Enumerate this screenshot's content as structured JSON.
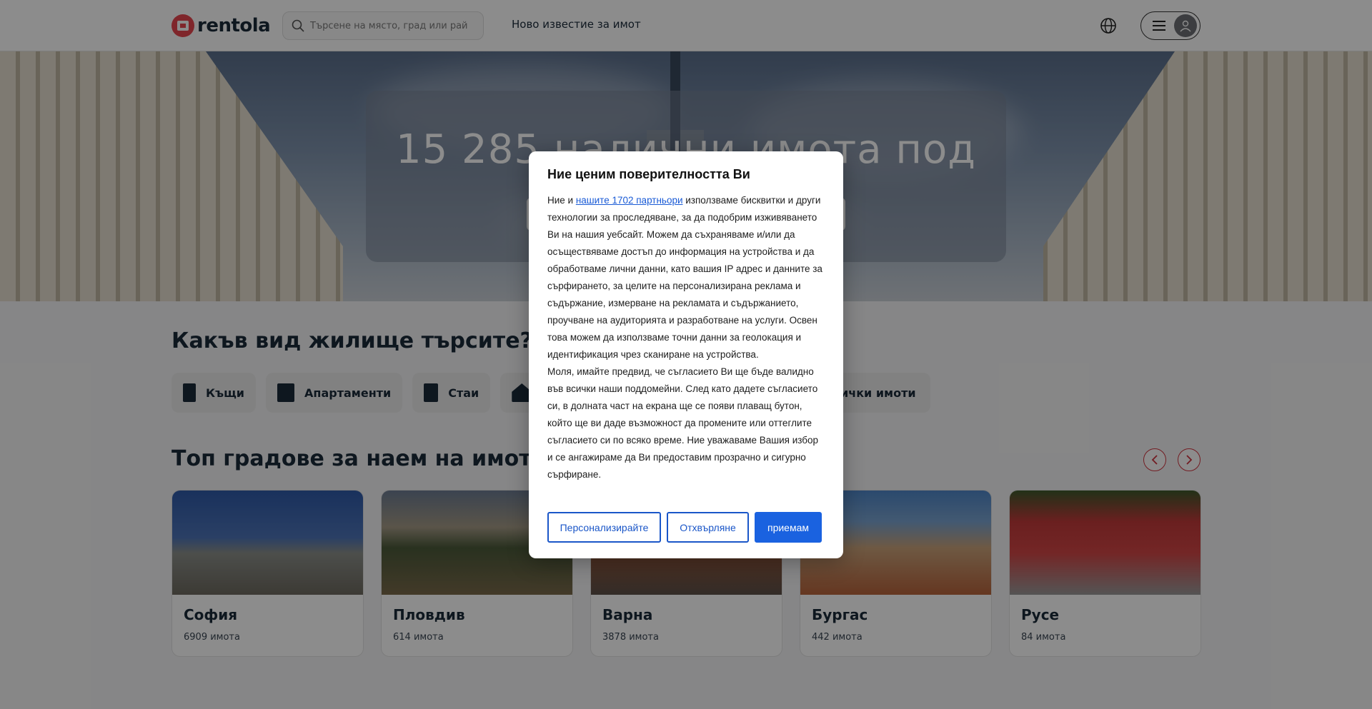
{
  "header": {
    "logo_text": "rentola",
    "search_placeholder": "Търсене на място, град или район",
    "nav_link": "Ново известие за имот"
  },
  "hero": {
    "title": "15 285 налични имота под наем"
  },
  "types_section": {
    "title": "Какъв вид жилище търсите?",
    "items": [
      {
        "label": "Къщи",
        "icon": "house-building-icon"
      },
      {
        "label": "Апартаменти",
        "icon": "apartment-icon"
      },
      {
        "label": "Стаи",
        "icon": "room-icon"
      },
      {
        "label": "",
        "icon": "house-icon"
      }
    ],
    "all_label": "ички имоти"
  },
  "cities_section": {
    "title": "Топ градове за наем на имоти",
    "cities": [
      {
        "name": "София",
        "count": "6909 имота"
      },
      {
        "name": "Пловдив",
        "count": "614 имота"
      },
      {
        "name": "Варна",
        "count": "3878 имота"
      },
      {
        "name": "Бургас",
        "count": "442 имота"
      },
      {
        "name": "Русе",
        "count": "84 имота"
      }
    ]
  },
  "modal": {
    "title": "Ние ценим поверителността Ви",
    "text_before_link": "Ние и ",
    "link_text": "нашите 1702 партньори",
    "text_after_link": " използваме бисквитки и други технологии за проследяване, за да подобрим изживяването Ви на нашия уебсайт. Можем да съхраняваме и/или да осъществяваме достъп до информация на устройства и да обработваме лични данни, като вашия IP адрес и данните за сърфирането, за целите на персонализирана реклама и съдържание, измерване на рекламата и съдържанието, проучване на аудиторията и разработване на услуги. Освен това можем да използваме точни данни за геолокация и идентификация чрез сканиране на устройства.",
    "paragraph2": "Моля, имайте предвид, че съгласието Ви ще бъде валидно във всички наши поддомейни. След като дадете съгласието си, в долната част на екрана ще се появи плаващ бутон, който ще ви даде възможност да промените или оттеглите съгласието си по всяко време. Ние уважаваме Вашия избор и се ангажираме да Ви предоставим прозрачно и сигурно сърфиране.",
    "btn_customize": "Персонализирайте",
    "btn_reject": "Отхвърляне",
    "btn_accept": "приемам"
  },
  "colors": {
    "brand": "#e8464f",
    "accent_blue": "#1a62e0",
    "arrow_red": "#d0343e"
  }
}
